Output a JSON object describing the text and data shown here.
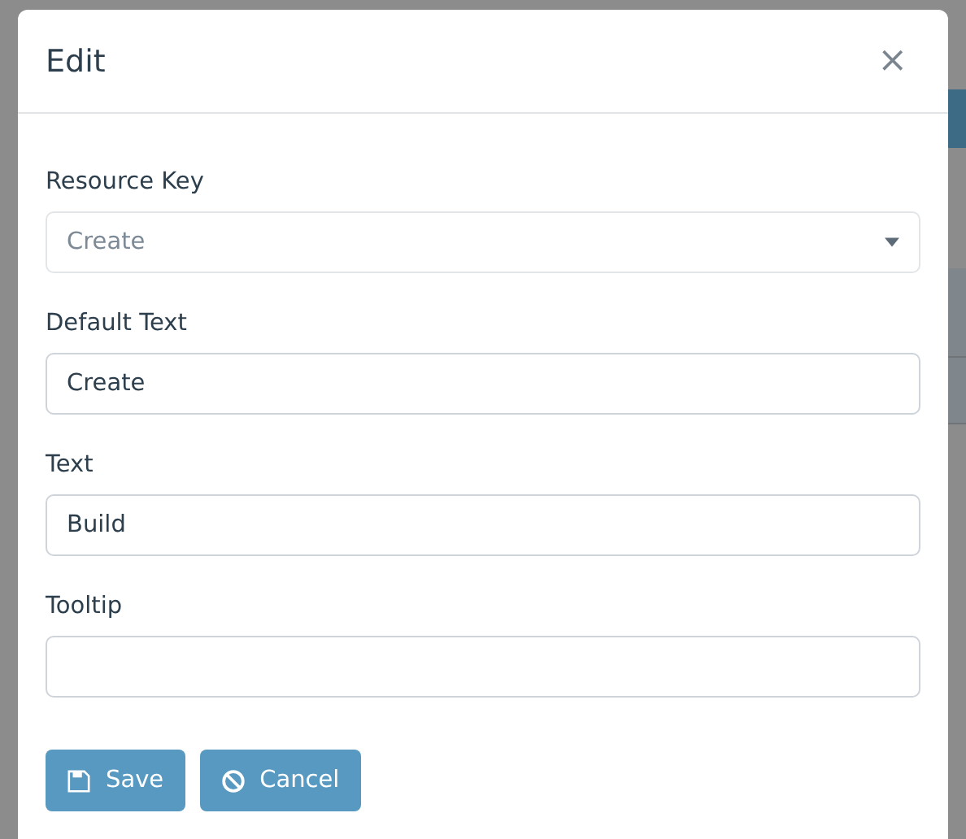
{
  "dialog": {
    "title": "Edit",
    "close": "×"
  },
  "fields": [
    {
      "label": "Resource Key",
      "kind": "select",
      "value": "Create",
      "disabled": true
    },
    {
      "label": "Default Text",
      "kind": "text",
      "value": "Create",
      "disabled": false
    },
    {
      "label": "Text",
      "kind": "text",
      "value": "Build",
      "disabled": false
    },
    {
      "label": "Tooltip",
      "kind": "text",
      "disabled": false
    }
  ],
  "buttons": [
    {
      "label": "Save",
      "kind": "save"
    },
    {
      "label": "Cancel",
      "kind": "cancel"
    }
  ]
}
